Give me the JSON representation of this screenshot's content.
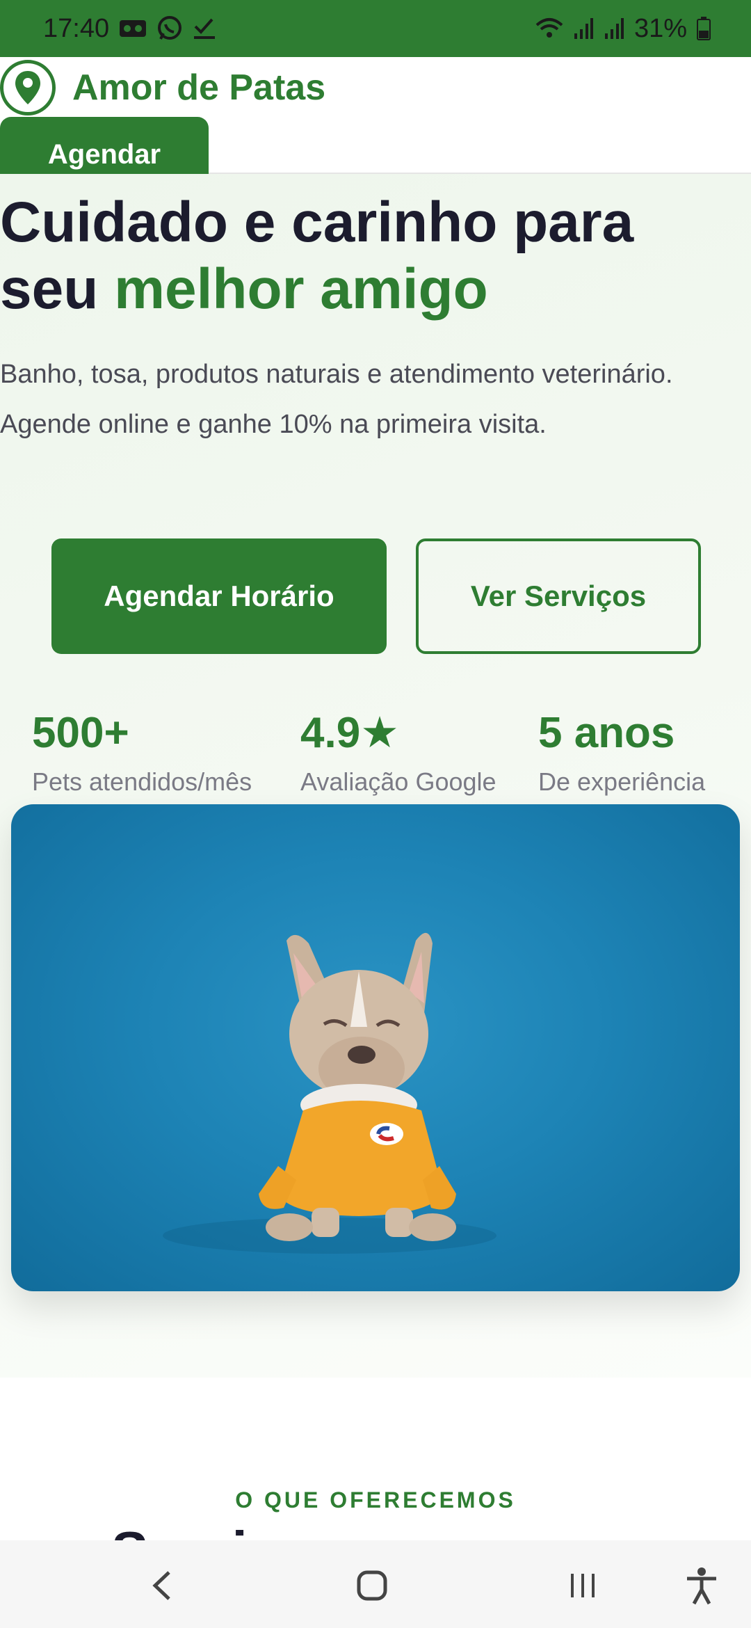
{
  "status_bar": {
    "time": "17:40",
    "left_icons": [
      "voicemail-icon",
      "whatsapp-icon",
      "check-icon"
    ],
    "right_icons": [
      "wifi-icon",
      "signal-icon",
      "signal-icon",
      "battery-icon"
    ],
    "battery": "31%"
  },
  "header": {
    "brand_icon": "location-pin-icon",
    "brand_name": "Amor de Patas",
    "cta_label": "Agendar"
  },
  "hero": {
    "title_part1": "Cuidado e carinho para seu ",
    "title_accent": "melhor amigo",
    "description": "Banho, tosa, produtos naturais e atendimento veterinário. Agende online e ganhe 10% na primeira visita.",
    "primary_button": "Agendar Horário",
    "secondary_button": "Ver Serviços",
    "stats": [
      {
        "value": "500+",
        "label": "Pets atendidos/mês"
      },
      {
        "value": "4.9★",
        "label": "Avaliação Google"
      },
      {
        "value": "5 anos",
        "label": "De experiência"
      }
    ],
    "image_subject": "french-bulldog-in-yellow-sweater"
  },
  "section": {
    "eyebrow": "O QUE OFERECEMOS",
    "title_peek": "Servi"
  },
  "nav_bar": {
    "icons": [
      "back-icon",
      "home-icon",
      "recents-icon",
      "accessibility-icon"
    ]
  },
  "colors": {
    "brand_green": "#2e7d32",
    "hero_bg": "#eef6ec",
    "image_blue": "#1d83b5"
  }
}
